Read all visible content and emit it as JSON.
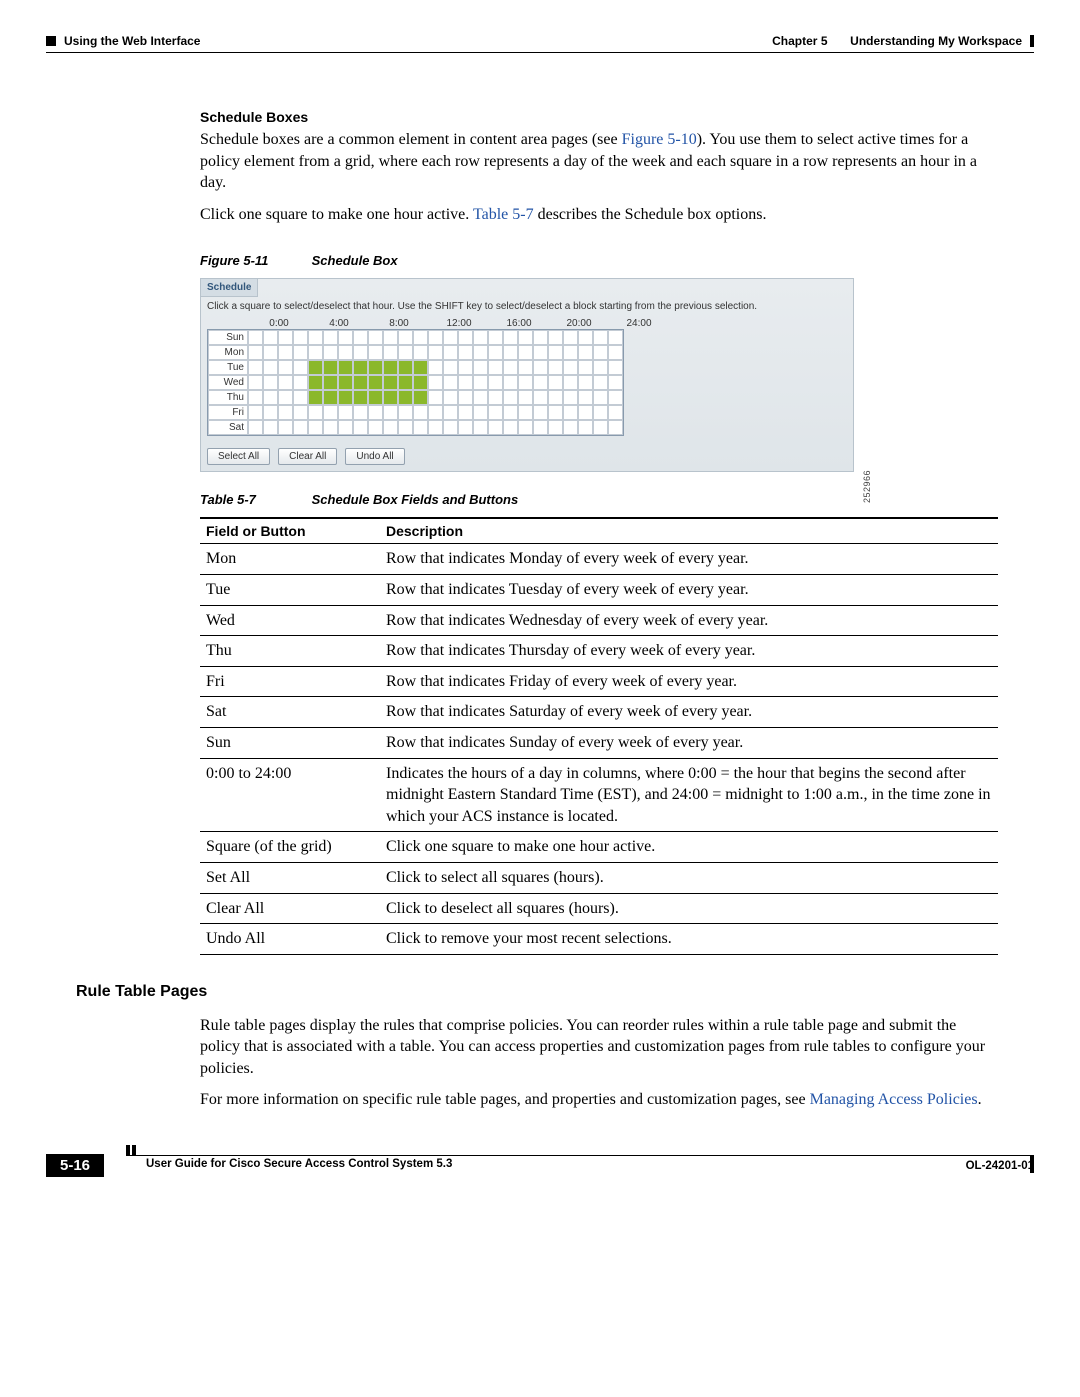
{
  "header": {
    "left": "Using the Web Interface",
    "right_chapter": "Chapter 5",
    "right_title": "Understanding My Workspace"
  },
  "section_schedule": {
    "heading": "Schedule Boxes",
    "para1_a": "Schedule boxes are a common element in content area pages (see ",
    "para1_link": "Figure 5-10",
    "para1_b": "). You use them to select active times for a policy element from a grid, where each row represents a day of the week and each square in a row represents an hour in a day.",
    "para2_a": "Click one square to make one hour active. ",
    "para2_link": "Table 5-7",
    "para2_b": " describes the Schedule box options.",
    "figure_label": "Figure 5-11",
    "figure_title": "Schedule Box",
    "table_label": "Table 5-7",
    "table_title": "Schedule Box Fields and Buttons"
  },
  "schedule_box": {
    "title": "Schedule",
    "hint": "Click a square to select/deselect that hour. Use the SHIFT key to select/deselect a block starting from the previous selection.",
    "times": [
      "0:00",
      "4:00",
      "8:00",
      "12:00",
      "16:00",
      "20:00",
      "24:00"
    ],
    "days": [
      "Sun",
      "Mon",
      "Tue",
      "Wed",
      "Thu",
      "Fri",
      "Sat"
    ],
    "buttons": {
      "select_all": "Select All",
      "clear_all": "Clear All",
      "undo_all": "Undo All"
    },
    "active_rows": [
      "Tue",
      "Wed",
      "Thu"
    ],
    "active_col_start": 4,
    "active_col_end": 11,
    "figure_id": "252966"
  },
  "fields_table": {
    "headers": [
      "Field or Button",
      "Description"
    ],
    "rows": [
      [
        "Mon",
        "Row that indicates Monday of every week of every year."
      ],
      [
        "Tue",
        "Row that indicates Tuesday of every week of every year."
      ],
      [
        "Wed",
        "Row that indicates Wednesday of every week of every year."
      ],
      [
        "Thu",
        "Row that indicates Thursday of every week of every year."
      ],
      [
        "Fri",
        "Row that indicates Friday of every week of every year."
      ],
      [
        "Sat",
        "Row that indicates Saturday of every week of every year."
      ],
      [
        "Sun",
        "Row that indicates Sunday of every week of every year."
      ],
      [
        "0:00 to 24:00",
        "Indicates the hours of a day in columns, where 0:00 = the hour that begins the second after midnight Eastern Standard Time (EST), and 24:00 = midnight to 1:00 a.m., in the time zone in which your ACS instance is located."
      ],
      [
        "Square (of the grid)",
        "Click one square to make one hour active."
      ],
      [
        "Set All",
        "Click to select all squares (hours)."
      ],
      [
        "Clear All",
        "Click to deselect all squares (hours)."
      ],
      [
        "Undo All",
        "Click to remove your most recent selections."
      ]
    ]
  },
  "section_rule": {
    "heading": "Rule Table Pages",
    "para1": "Rule table pages display the rules that comprise policies. You can reorder rules within a rule table page and submit the policy that is associated with a table. You can access properties and customization pages from rule tables to configure your policies.",
    "para2_a": "For more information on specific rule table pages, and properties and customization pages, see ",
    "para2_link": "Managing Access Policies",
    "para2_b": "."
  },
  "footer": {
    "doc_title": "User Guide for Cisco Secure Access Control System 5.3",
    "page_num": "5-16",
    "ol": "OL-24201-01"
  }
}
